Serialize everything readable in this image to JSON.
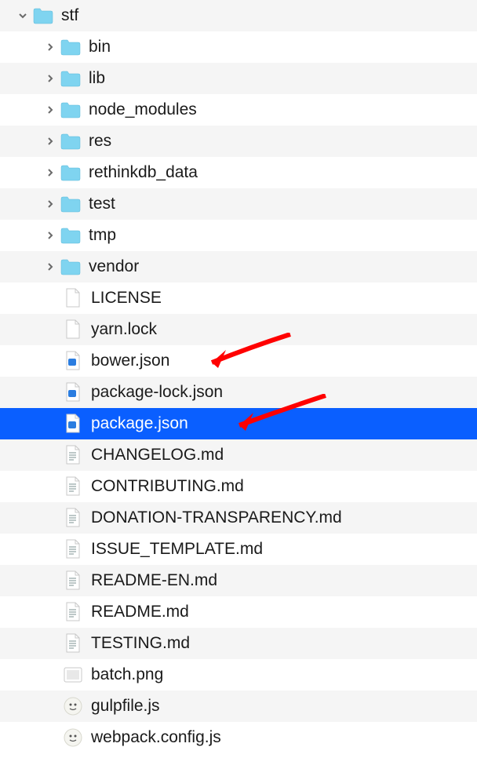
{
  "root": {
    "name": "stf",
    "expanded": true
  },
  "items": [
    {
      "name": "bin",
      "type": "folder",
      "expandable": true
    },
    {
      "name": "lib",
      "type": "folder",
      "expandable": true
    },
    {
      "name": "node_modules",
      "type": "folder",
      "expandable": true
    },
    {
      "name": "res",
      "type": "folder",
      "expandable": true
    },
    {
      "name": "rethinkdb_data",
      "type": "folder",
      "expandable": true
    },
    {
      "name": "test",
      "type": "folder",
      "expandable": true
    },
    {
      "name": "tmp",
      "type": "folder",
      "expandable": true
    },
    {
      "name": "vendor",
      "type": "folder",
      "expandable": true
    },
    {
      "name": "LICENSE",
      "type": "file-blank",
      "expandable": false
    },
    {
      "name": "yarn.lock",
      "type": "file-blank",
      "expandable": false
    },
    {
      "name": "bower.json",
      "type": "file-json",
      "expandable": false,
      "annotated": true
    },
    {
      "name": "package-lock.json",
      "type": "file-json",
      "expandable": false
    },
    {
      "name": "package.json",
      "type": "file-json",
      "expandable": false,
      "selected": true,
      "annotated": true
    },
    {
      "name": "CHANGELOG.md",
      "type": "file-md",
      "expandable": false
    },
    {
      "name": "CONTRIBUTING.md",
      "type": "file-md",
      "expandable": false
    },
    {
      "name": "DONATION-TRANSPARENCY.md",
      "type": "file-md",
      "expandable": false
    },
    {
      "name": "ISSUE_TEMPLATE.md",
      "type": "file-md",
      "expandable": false
    },
    {
      "name": "README-EN.md",
      "type": "file-md",
      "expandable": false
    },
    {
      "name": "README.md",
      "type": "file-md",
      "expandable": false
    },
    {
      "name": "TESTING.md",
      "type": "file-md",
      "expandable": false
    },
    {
      "name": "batch.png",
      "type": "file-image",
      "expandable": false
    },
    {
      "name": "gulpfile.js",
      "type": "file-js",
      "expandable": false
    },
    {
      "name": "webpack.config.js",
      "type": "file-js",
      "expandable": false
    }
  ],
  "annotations": {
    "arrow_color": "#ff0000"
  }
}
